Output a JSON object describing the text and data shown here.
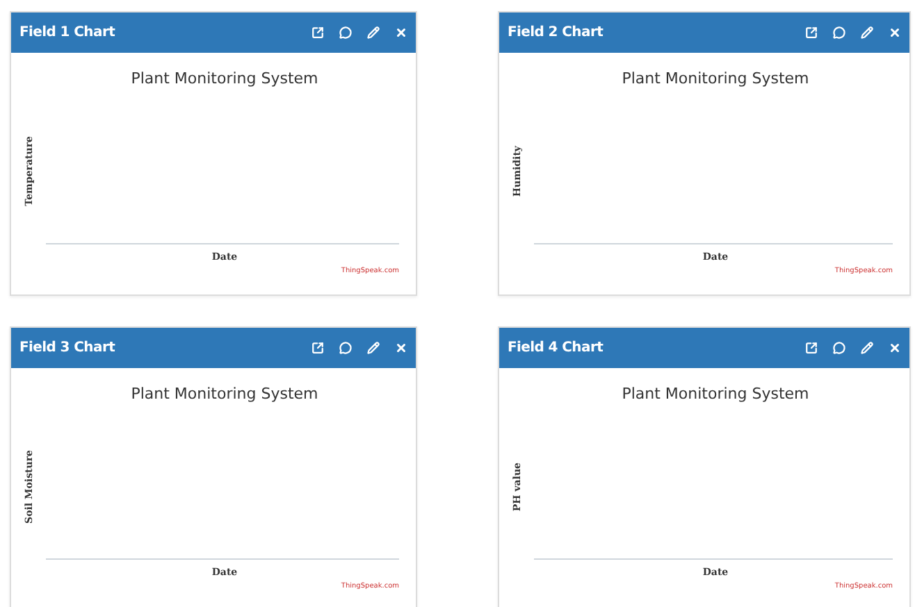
{
  "cards": [
    {
      "title": "Field 1 Chart",
      "chart_title": "Plant Monitoring System",
      "ylabel": "Temperature",
      "xlabel": "Date",
      "credit": "ThingSpeak.com"
    },
    {
      "title": "Field 2 Chart",
      "chart_title": "Plant Monitoring System",
      "ylabel": "Humidity",
      "xlabel": "Date",
      "credit": "ThingSpeak.com"
    },
    {
      "title": "Field 3 Chart",
      "chart_title": "Plant Monitoring System",
      "ylabel": "Soil Moisture",
      "xlabel": "Date",
      "credit": "ThingSpeak.com"
    },
    {
      "title": "Field 4 Chart",
      "chart_title": "Plant Monitoring System",
      "ylabel": "PH value",
      "xlabel": "Date",
      "credit": "ThingSpeak.com"
    }
  ]
}
